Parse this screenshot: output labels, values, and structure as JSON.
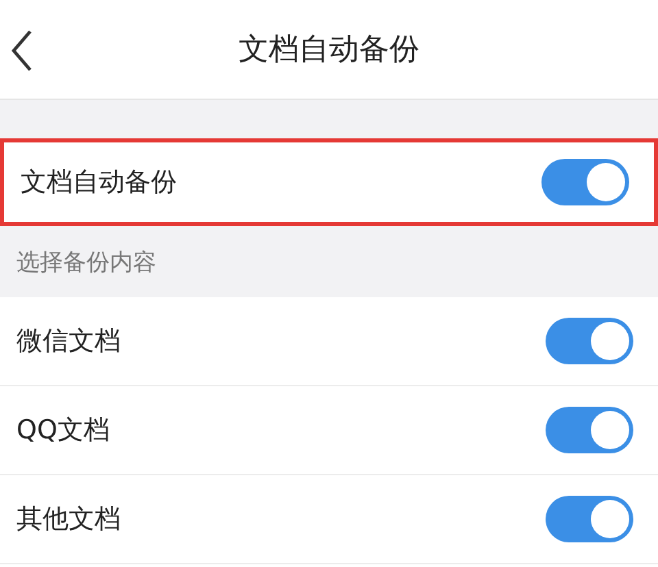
{
  "header": {
    "title": "文档自动备份"
  },
  "main_setting": {
    "label": "文档自动备份",
    "on": true,
    "highlighted": true
  },
  "section": {
    "title": "选择备份内容"
  },
  "items": [
    {
      "label": "微信文档",
      "on": true
    },
    {
      "label": "QQ文档",
      "on": true
    },
    {
      "label": "其他文档",
      "on": true
    }
  ]
}
